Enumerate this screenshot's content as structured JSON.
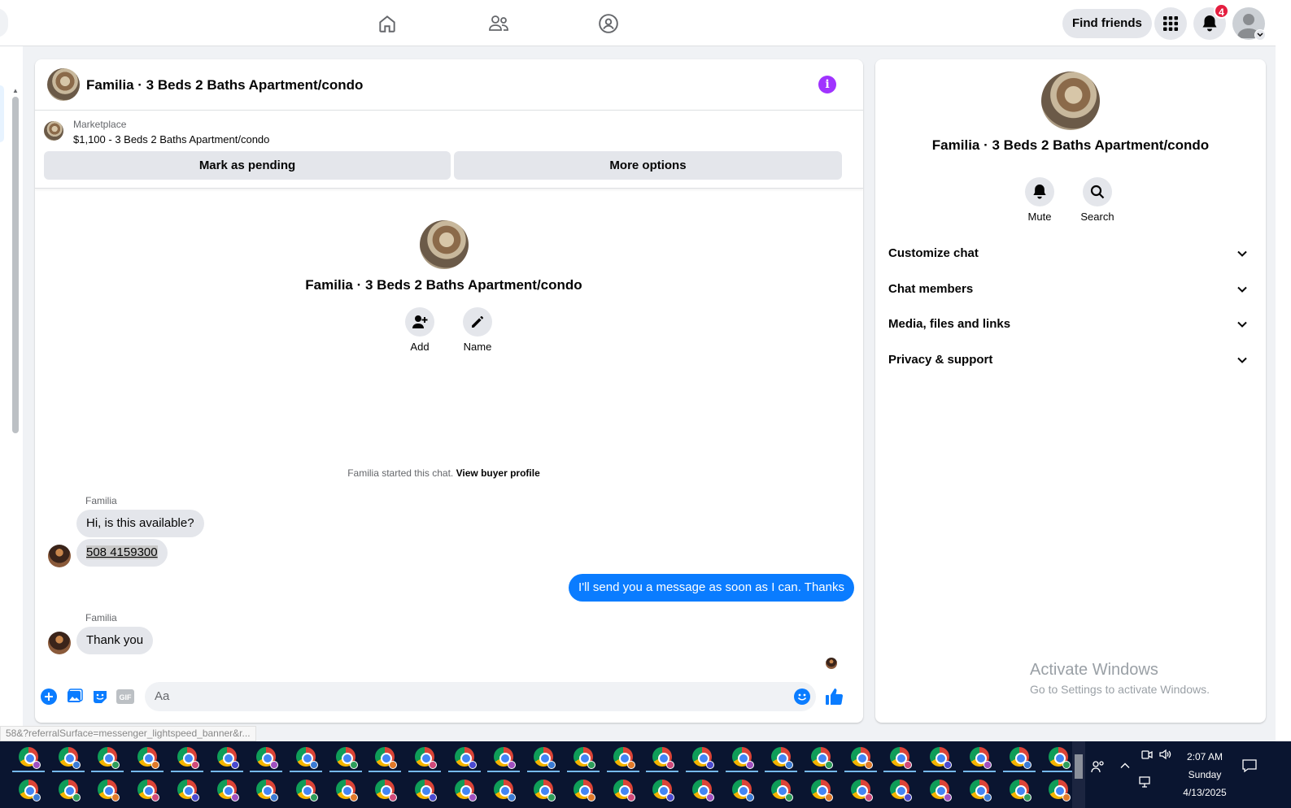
{
  "topnav": {
    "find_friends_label": "Find friends",
    "notification_count": "4"
  },
  "chat": {
    "title": "Familia · 3 Beds 2 Baths Apartment/condo",
    "listing": {
      "kicker": "Marketplace",
      "price_line": "$1,100 - 3 Beds 2 Baths Apartment/condo",
      "mark_pending_label": "Mark as pending",
      "more_options_label": "More options"
    },
    "intro": {
      "name": "Familia · 3 Beds 2 Baths Apartment/condo",
      "add_label": "Add",
      "name_label": "Name"
    },
    "started_text": "Familia started this chat.",
    "view_buyer_profile": "View buyer profile",
    "messages": [
      {
        "sender": "Familia",
        "text": "Hi, is this available?"
      },
      {
        "sender": "",
        "text": "508 4159300"
      },
      {
        "sender": "me",
        "text": "I'll send you a message as soon as I can. Thanks"
      },
      {
        "sender": "Familia",
        "text": "Thank you"
      }
    ],
    "composer_placeholder": "Aa"
  },
  "info_panel": {
    "name": "Familia · 3 Beds 2 Baths Apartment/condo",
    "mute_label": "Mute",
    "search_label": "Search",
    "sections": [
      "Customize chat",
      "Chat members",
      "Media, files and links",
      "Privacy & support"
    ]
  },
  "watermark": {
    "line1": "Activate Windows",
    "line2": "Go to Settings to activate Windows."
  },
  "status_url": "58&?referralSurface=messenger_lightspeed_banner&r...",
  "taskbar": {
    "time": "2:07 AM",
    "day": "Sunday",
    "date": "4/13/2025"
  },
  "colors": {
    "accent_blue": "#0a7cff",
    "info_purple": "#a033ff",
    "badge_red": "#e41e3f"
  }
}
